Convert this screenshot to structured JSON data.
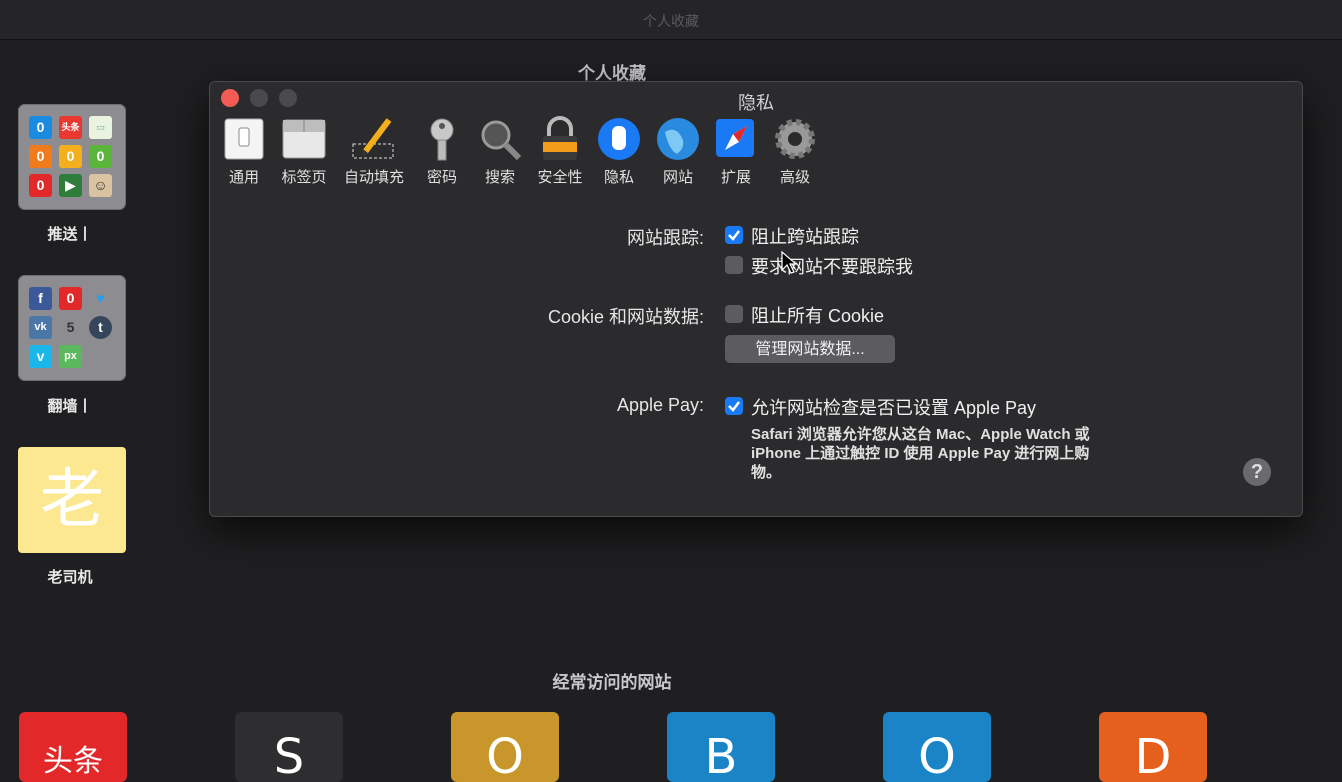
{
  "topbar": {
    "title": "个人收藏"
  },
  "favorites": {
    "heading": "个人收藏",
    "folders": [
      {
        "label": "推送丨"
      },
      {
        "label": "翻墙丨"
      }
    ],
    "laosiji": {
      "glyph": "老",
      "label": "老司机"
    }
  },
  "frequent": {
    "heading": "经常访问的网站",
    "tiles": [
      "头条",
      "S",
      "O",
      "B",
      "O",
      "D"
    ]
  },
  "window": {
    "title": "隐私",
    "toolbar": [
      {
        "label": "通用",
        "icon": "switch-icon"
      },
      {
        "label": "标签页",
        "icon": "tabs-icon"
      },
      {
        "label": "自动填充",
        "icon": "pencil-icon"
      },
      {
        "label": "密码",
        "icon": "key-icon"
      },
      {
        "label": "搜索",
        "icon": "magnifier-icon"
      },
      {
        "label": "安全性",
        "icon": "padlock-icon"
      },
      {
        "label": "隐私",
        "icon": "hand-icon"
      },
      {
        "label": "网站",
        "icon": "globe-icon"
      },
      {
        "label": "扩展",
        "icon": "compass-icon"
      },
      {
        "label": "高级",
        "icon": "gear-icon"
      }
    ],
    "tracking": {
      "label": "网站跟踪:",
      "prevent_cross_site": "阻止跨站跟踪",
      "do_not_track": "要求网站不要跟踪我"
    },
    "cookies": {
      "label": "Cookie 和网站数据:",
      "block_all": "阻止所有 Cookie",
      "manage_button": "管理网站数据..."
    },
    "apple_pay": {
      "label": "Apple Pay:",
      "allow": "允许网站检查是否已设置 Apple Pay",
      "description": "Safari 浏览器允许您从这台 Mac、Apple Watch 或 iPhone 上通过触控 ID 使用 Apple Pay 进行网上购物。"
    },
    "help": "?"
  },
  "colors": {
    "accent": "#1a7af6",
    "close": "#f35b54",
    "window_bg": "#2b2b2d",
    "page_bg": "#1f1f21"
  }
}
